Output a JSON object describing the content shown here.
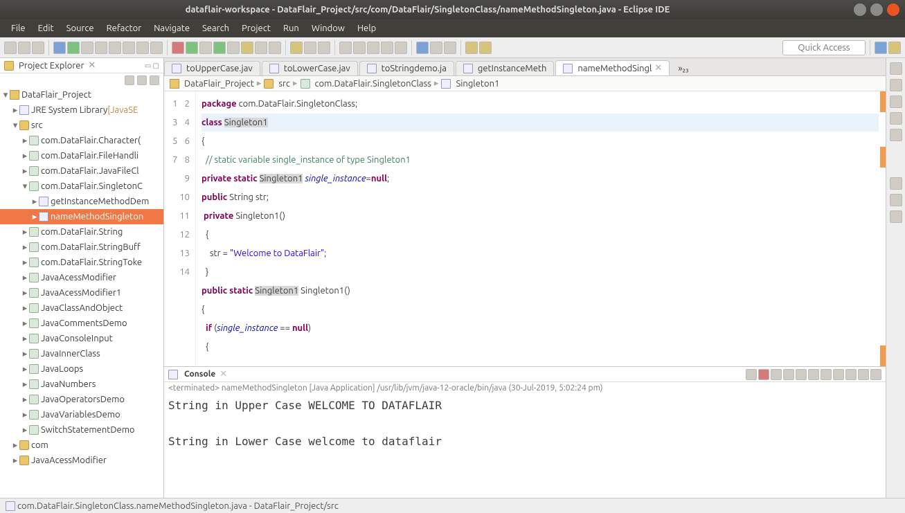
{
  "window": {
    "title": "dataflair-workspace - DataFlair_Project/src/com/DataFlair/SingletonClass/nameMethodSingleton.java - Eclipse IDE"
  },
  "menu": {
    "file": "File",
    "edit": "Edit",
    "source": "Source",
    "refactor": "Refactor",
    "navigate": "Navigate",
    "search": "Search",
    "project": "Project",
    "run": "Run",
    "window": "Window",
    "help": "Help"
  },
  "quick": "Quick Access",
  "pe": {
    "title": "Project Explorer",
    "nodes": {
      "root": "DataFlair_Project",
      "jre": "JRE System Library",
      "jresuffix": "[JavaSE",
      "src": "src",
      "pkgs": [
        "com.DataFlair.Character(",
        "com.DataFlair.FileHandli",
        "com.DataFlair.JavaFileCl",
        "com.DataFlair.SingletonC"
      ],
      "singletonChildren": [
        "getInstanceMethodDem",
        "nameMethodSingleton"
      ],
      "morepkgs": [
        "com.DataFlair.String",
        "com.DataFlair.StringBuff",
        "com.DataFlair.StringToke"
      ],
      "plain": [
        "JavaAcessModifier",
        "JavaAcessModifier1",
        "JavaClassAndObject",
        "JavaCommentsDemo",
        "JavaConsoleInput",
        "JavaInnerClass",
        "JavaLoops",
        "JavaNumbers",
        "JavaOperatorsDemo",
        "JavaVariablesDemo",
        "SwitchStatementDemo",
        "com",
        "JavaAcessModifier"
      ]
    }
  },
  "tabs": {
    "t1": "toUpperCase.jav",
    "t2": "toLowerCase.jav",
    "t3": "toStringdemo.ja",
    "t4": "getInstanceMeth",
    "t5": "nameMethodSingl",
    "overflow": "»₂₃"
  },
  "breadcrumb": {
    "b1": "DataFlair_Project",
    "b2": "src",
    "b3": "com.DataFlair.SingletonClass",
    "b4": "Singleton1"
  },
  "code": {
    "l1a": "package",
    "l1b": " com.DataFlair.SingletonClass;",
    "l2a": "class",
    "l2b": " ",
    "l2c": "Singleton1",
    "l3": "{",
    "l4": "  // static variable single_instance of type Singleton1",
    "l5a": "private",
    "l5b": " ",
    "l5c": "static",
    "l5d": " ",
    "l5e": "Singleton1",
    "l5f": " ",
    "l5g": "single_instance",
    "l5h": "=",
    "l5i": "null",
    "l5j": ";",
    "l6a": "public",
    "l6b": " String str;",
    "l7a": " ",
    "l7b": "private",
    "l7c": " Singleton1()",
    "l8": "  {",
    "l9a": "    str = ",
    "l9b": "\"Welcome to DataFlair\"",
    "l9c": ";",
    "l10": "  }",
    "l11a": "public",
    "l11b": " ",
    "l11c": "static",
    "l11d": " ",
    "l11e": "Singleton1",
    "l11f": " Singleton1()",
    "l12": "{",
    "l13a": "  if",
    "l13b": " (",
    "l13c": "single_instance",
    "l13d": " == ",
    "l13e": "null",
    "l13f": ")",
    "l14": "  {",
    "gut": [
      "1",
      "2",
      "3",
      "4",
      "5",
      "6",
      "7",
      "8",
      "9",
      "10",
      "11",
      "12",
      "13",
      "14"
    ]
  },
  "console": {
    "title": "Console",
    "meta": "<terminated> nameMethodSingleton [Java Application] /usr/lib/jvm/java-12-oracle/bin/java (30-Jul-2019, 5:02:24 pm)",
    "out": "String in Upper Case WELCOME TO DATAFLAIR\n\nString in Lower Case welcome to dataflair"
  },
  "status": "com.DataFlair.SingletonClass.nameMethodSingleton.java - DataFlair_Project/src"
}
